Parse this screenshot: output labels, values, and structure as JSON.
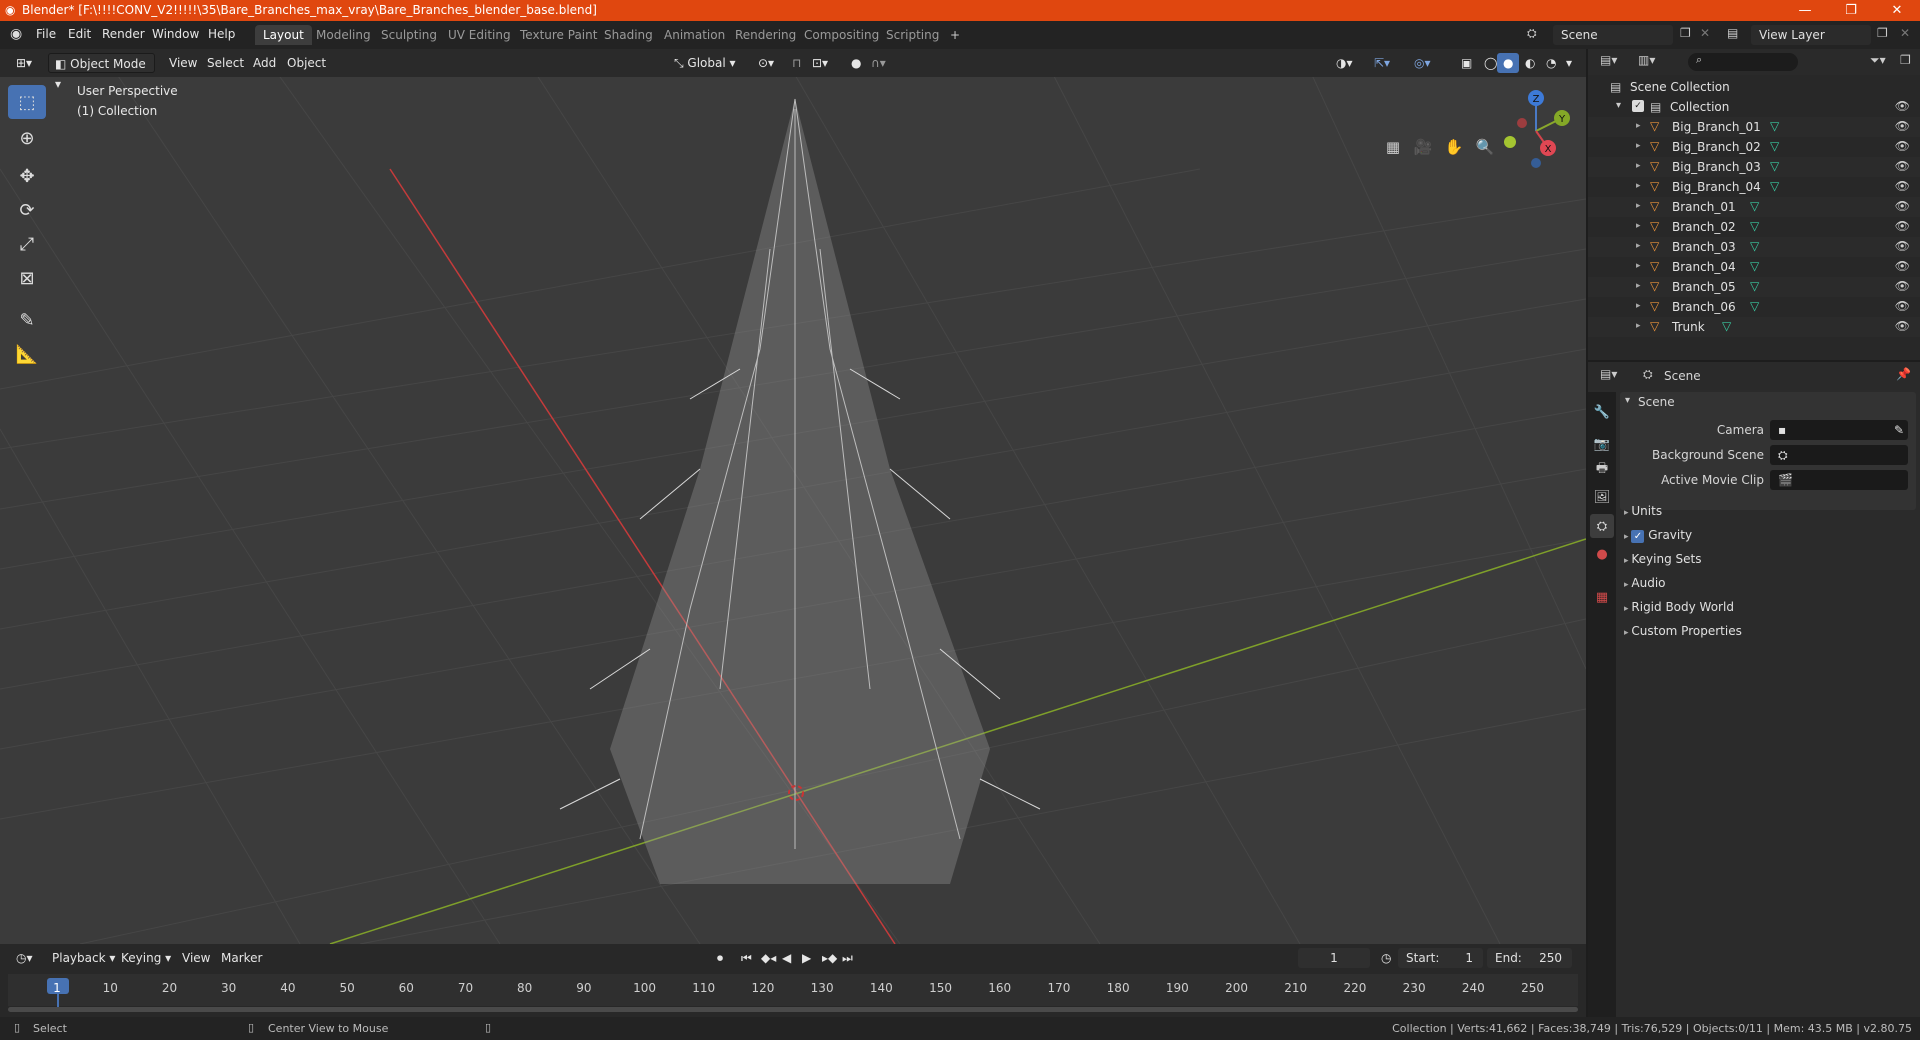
{
  "window": {
    "title": "Blender* [F:\\!!!!CONV_V2!!!!!\\35\\Bare_Branches_max_vray\\Bare_Branches_blender_base.blend]",
    "controls": [
      "—",
      "❐",
      "✕"
    ]
  },
  "menu": [
    "File",
    "Edit",
    "Render",
    "Window",
    "Help"
  ],
  "workspaces": {
    "tabs": [
      "Layout",
      "Modeling",
      "Sculpting",
      "UV Editing",
      "Texture Paint",
      "Shading",
      "Animation",
      "Rendering",
      "Compositing",
      "Scripting"
    ],
    "active": "Layout",
    "add": "+"
  },
  "scene_field": "Scene",
  "view_layer_field": "View Layer",
  "viewport": {
    "mode": "Object Mode",
    "menus": [
      "View",
      "Select",
      "Add",
      "Object"
    ],
    "orientation": "Global",
    "info_line1": "User Perspective",
    "info_line2": "(1) Collection",
    "gizmo_axes": [
      "Z",
      "Y",
      "X"
    ]
  },
  "outliner": {
    "root": "Scene Collection",
    "collection": "Collection",
    "objects": [
      "Big_Branch_01",
      "Big_Branch_02",
      "Big_Branch_03",
      "Big_Branch_04",
      "Branch_01",
      "Branch_02",
      "Branch_03",
      "Branch_04",
      "Branch_05",
      "Branch_06",
      "Trunk"
    ]
  },
  "properties": {
    "context": "Scene",
    "panel_title": "Scene",
    "fields": [
      {
        "label": "Camera",
        "value": ""
      },
      {
        "label": "Background Scene",
        "value": ""
      },
      {
        "label": "Active Movie Clip",
        "value": ""
      }
    ],
    "subpanels": [
      "Units",
      "Gravity",
      "Keying Sets",
      "Audio",
      "Rigid Body World",
      "Custom Properties"
    ],
    "gravity_checked": true
  },
  "timeline": {
    "menus": [
      "Playback",
      "Keying",
      "View",
      "Marker"
    ],
    "current_frame": "1",
    "start_label": "Start:",
    "start": "1",
    "end_label": "End:",
    "end": "250",
    "ticks": [
      "1",
      "10",
      "20",
      "30",
      "40",
      "50",
      "60",
      "70",
      "80",
      "90",
      "100",
      "110",
      "120",
      "130",
      "140",
      "150",
      "160",
      "170",
      "180",
      "190",
      "200",
      "210",
      "220",
      "230",
      "240",
      "250"
    ]
  },
  "statusbar": {
    "left_action": "Select",
    "mid_action": "Center View to Mouse",
    "stats": "Collection | Verts:41,662 | Faces:38,749 | Tris:76,529 | Objects:0/11 | Mem: 43.5 MB | v2.80.75"
  },
  "colors": {
    "title_bar": "#e0470f",
    "accent": "#4772b3",
    "viewport_bg": "#3b3b3b",
    "x_axis": "#c43b3b",
    "y_axis": "#7fa02a",
    "object_icon": "#e8923a",
    "mesh_icon": "#39c9a0"
  }
}
